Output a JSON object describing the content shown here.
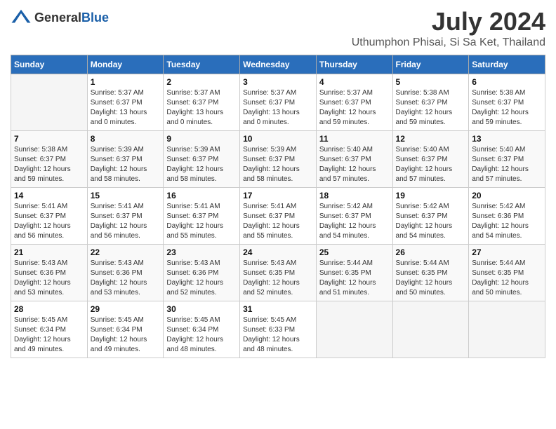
{
  "logo": {
    "general": "General",
    "blue": "Blue"
  },
  "title": "July 2024",
  "subtitle": "Uthumphon Phisai, Si Sa Ket, Thailand",
  "headers": [
    "Sunday",
    "Monday",
    "Tuesday",
    "Wednesday",
    "Thursday",
    "Friday",
    "Saturday"
  ],
  "weeks": [
    [
      {
        "num": "",
        "sunrise": "",
        "sunset": "",
        "daylight": "",
        "empty": true
      },
      {
        "num": "1",
        "sunrise": "Sunrise: 5:37 AM",
        "sunset": "Sunset: 6:37 PM",
        "daylight": "Daylight: 13 hours and 0 minutes."
      },
      {
        "num": "2",
        "sunrise": "Sunrise: 5:37 AM",
        "sunset": "Sunset: 6:37 PM",
        "daylight": "Daylight: 13 hours and 0 minutes."
      },
      {
        "num": "3",
        "sunrise": "Sunrise: 5:37 AM",
        "sunset": "Sunset: 6:37 PM",
        "daylight": "Daylight: 13 hours and 0 minutes."
      },
      {
        "num": "4",
        "sunrise": "Sunrise: 5:37 AM",
        "sunset": "Sunset: 6:37 PM",
        "daylight": "Daylight: 12 hours and 59 minutes."
      },
      {
        "num": "5",
        "sunrise": "Sunrise: 5:38 AM",
        "sunset": "Sunset: 6:37 PM",
        "daylight": "Daylight: 12 hours and 59 minutes."
      },
      {
        "num": "6",
        "sunrise": "Sunrise: 5:38 AM",
        "sunset": "Sunset: 6:37 PM",
        "daylight": "Daylight: 12 hours and 59 minutes."
      }
    ],
    [
      {
        "num": "7",
        "sunrise": "Sunrise: 5:38 AM",
        "sunset": "Sunset: 6:37 PM",
        "daylight": "Daylight: 12 hours and 59 minutes."
      },
      {
        "num": "8",
        "sunrise": "Sunrise: 5:39 AM",
        "sunset": "Sunset: 6:37 PM",
        "daylight": "Daylight: 12 hours and 58 minutes."
      },
      {
        "num": "9",
        "sunrise": "Sunrise: 5:39 AM",
        "sunset": "Sunset: 6:37 PM",
        "daylight": "Daylight: 12 hours and 58 minutes."
      },
      {
        "num": "10",
        "sunrise": "Sunrise: 5:39 AM",
        "sunset": "Sunset: 6:37 PM",
        "daylight": "Daylight: 12 hours and 58 minutes."
      },
      {
        "num": "11",
        "sunrise": "Sunrise: 5:40 AM",
        "sunset": "Sunset: 6:37 PM",
        "daylight": "Daylight: 12 hours and 57 minutes."
      },
      {
        "num": "12",
        "sunrise": "Sunrise: 5:40 AM",
        "sunset": "Sunset: 6:37 PM",
        "daylight": "Daylight: 12 hours and 57 minutes."
      },
      {
        "num": "13",
        "sunrise": "Sunrise: 5:40 AM",
        "sunset": "Sunset: 6:37 PM",
        "daylight": "Daylight: 12 hours and 57 minutes."
      }
    ],
    [
      {
        "num": "14",
        "sunrise": "Sunrise: 5:41 AM",
        "sunset": "Sunset: 6:37 PM",
        "daylight": "Daylight: 12 hours and 56 minutes."
      },
      {
        "num": "15",
        "sunrise": "Sunrise: 5:41 AM",
        "sunset": "Sunset: 6:37 PM",
        "daylight": "Daylight: 12 hours and 56 minutes."
      },
      {
        "num": "16",
        "sunrise": "Sunrise: 5:41 AM",
        "sunset": "Sunset: 6:37 PM",
        "daylight": "Daylight: 12 hours and 55 minutes."
      },
      {
        "num": "17",
        "sunrise": "Sunrise: 5:41 AM",
        "sunset": "Sunset: 6:37 PM",
        "daylight": "Daylight: 12 hours and 55 minutes."
      },
      {
        "num": "18",
        "sunrise": "Sunrise: 5:42 AM",
        "sunset": "Sunset: 6:37 PM",
        "daylight": "Daylight: 12 hours and 54 minutes."
      },
      {
        "num": "19",
        "sunrise": "Sunrise: 5:42 AM",
        "sunset": "Sunset: 6:37 PM",
        "daylight": "Daylight: 12 hours and 54 minutes."
      },
      {
        "num": "20",
        "sunrise": "Sunrise: 5:42 AM",
        "sunset": "Sunset: 6:36 PM",
        "daylight": "Daylight: 12 hours and 54 minutes."
      }
    ],
    [
      {
        "num": "21",
        "sunrise": "Sunrise: 5:43 AM",
        "sunset": "Sunset: 6:36 PM",
        "daylight": "Daylight: 12 hours and 53 minutes."
      },
      {
        "num": "22",
        "sunrise": "Sunrise: 5:43 AM",
        "sunset": "Sunset: 6:36 PM",
        "daylight": "Daylight: 12 hours and 53 minutes."
      },
      {
        "num": "23",
        "sunrise": "Sunrise: 5:43 AM",
        "sunset": "Sunset: 6:36 PM",
        "daylight": "Daylight: 12 hours and 52 minutes."
      },
      {
        "num": "24",
        "sunrise": "Sunrise: 5:43 AM",
        "sunset": "Sunset: 6:35 PM",
        "daylight": "Daylight: 12 hours and 52 minutes."
      },
      {
        "num": "25",
        "sunrise": "Sunrise: 5:44 AM",
        "sunset": "Sunset: 6:35 PM",
        "daylight": "Daylight: 12 hours and 51 minutes."
      },
      {
        "num": "26",
        "sunrise": "Sunrise: 5:44 AM",
        "sunset": "Sunset: 6:35 PM",
        "daylight": "Daylight: 12 hours and 50 minutes."
      },
      {
        "num": "27",
        "sunrise": "Sunrise: 5:44 AM",
        "sunset": "Sunset: 6:35 PM",
        "daylight": "Daylight: 12 hours and 50 minutes."
      }
    ],
    [
      {
        "num": "28",
        "sunrise": "Sunrise: 5:45 AM",
        "sunset": "Sunset: 6:34 PM",
        "daylight": "Daylight: 12 hours and 49 minutes."
      },
      {
        "num": "29",
        "sunrise": "Sunrise: 5:45 AM",
        "sunset": "Sunset: 6:34 PM",
        "daylight": "Daylight: 12 hours and 49 minutes."
      },
      {
        "num": "30",
        "sunrise": "Sunrise: 5:45 AM",
        "sunset": "Sunset: 6:34 PM",
        "daylight": "Daylight: 12 hours and 48 minutes."
      },
      {
        "num": "31",
        "sunrise": "Sunrise: 5:45 AM",
        "sunset": "Sunset: 6:33 PM",
        "daylight": "Daylight: 12 hours and 48 minutes."
      },
      {
        "num": "",
        "sunrise": "",
        "sunset": "",
        "daylight": "",
        "empty": true
      },
      {
        "num": "",
        "sunrise": "",
        "sunset": "",
        "daylight": "",
        "empty": true
      },
      {
        "num": "",
        "sunrise": "",
        "sunset": "",
        "daylight": "",
        "empty": true
      }
    ]
  ]
}
